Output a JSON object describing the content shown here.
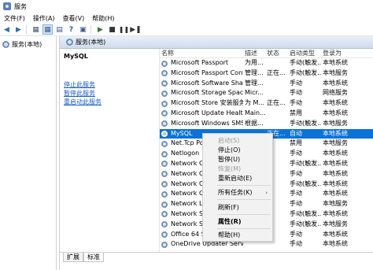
{
  "window": {
    "title": "服务"
  },
  "menubar": {
    "items": [
      "文件(F)",
      "操作(A)",
      "查看(V)",
      "帮助(H)"
    ]
  },
  "tree": {
    "item_label": "服务(本地)"
  },
  "content": {
    "header_title": "服务(本地)"
  },
  "description": {
    "service_name": "MySQL",
    "links": [
      "停止此服务",
      "暂停此服务",
      "重启动此服务"
    ]
  },
  "table": {
    "columns": [
      "名称",
      "描述",
      "状态",
      "启动类型",
      "登录为"
    ],
    "rows": [
      {
        "name": "Microsoft Passport",
        "desc": "为用...",
        "status": "",
        "startup": "手动(触发...",
        "logon": "本地系统"
      },
      {
        "name": "Microsoft Passport Container",
        "desc": "管理...",
        "status": "正在...",
        "startup": "手动(触发...",
        "logon": "本地服务"
      },
      {
        "name": "Microsoft Software Shado...",
        "desc": "管理...",
        "status": "",
        "startup": "手动",
        "logon": "本地系统"
      },
      {
        "name": "Microsoft Storage Spaces S...",
        "desc": "Micr...",
        "status": "",
        "startup": "手动",
        "logon": "网络服务"
      },
      {
        "name": "Microsoft Store 安装服务",
        "desc": "为 M...",
        "status": "正在...",
        "startup": "手动",
        "logon": "本地系统"
      },
      {
        "name": "Microsoft Update Health S...",
        "desc": "Main...",
        "status": "",
        "startup": "禁用",
        "logon": "本地系统"
      },
      {
        "name": "Microsoft Windows SMS 路...",
        "desc": "根据...",
        "status": "",
        "startup": "手动(触发...",
        "logon": "本地服务"
      },
      {
        "name": "MySQL",
        "desc": "",
        "status": "正在...",
        "startup": "自动",
        "logon": "本地系统",
        "selected": true
      },
      {
        "name": "Net.Tcp Port",
        "desc": "",
        "status": "",
        "startup": "禁用",
        "logon": "本地服务"
      },
      {
        "name": "Netlogon",
        "desc": "",
        "status": "",
        "startup": "手动",
        "logon": "本地系统"
      },
      {
        "name": "Network Con",
        "desc": "",
        "status": "",
        "startup": "手动(触发...",
        "logon": "本地系统"
      },
      {
        "name": "Network Con",
        "desc": "",
        "status": "",
        "startup": "手动",
        "logon": "本地系统"
      },
      {
        "name": "Network Con",
        "desc": "",
        "status": "",
        "startup": "手动(触发...",
        "logon": "本地系统"
      },
      {
        "name": "Network Con",
        "desc": "",
        "status": "",
        "startup": "手动",
        "logon": "本地系统"
      },
      {
        "name": "Network List",
        "desc": "",
        "status": "",
        "startup": "手动",
        "logon": "本地服务"
      },
      {
        "name": "Network Setu",
        "desc": "",
        "status": "",
        "startup": "手动(触发...",
        "logon": "本地系统"
      },
      {
        "name": "Network Stor",
        "desc": "",
        "status": "",
        "startup": "手动(触发...",
        "logon": "本地服务"
      },
      {
        "name": "Office 64 Source Engine",
        "desc": "",
        "status": "",
        "startup": "手动",
        "logon": "本地系统"
      },
      {
        "name": "OneDrive Updater Service",
        "desc": "",
        "status": "",
        "startup": "手动",
        "logon": "本地系统"
      }
    ]
  },
  "tabs": [
    "扩展",
    "标准"
  ],
  "context_menu": {
    "items": [
      {
        "label": "启动(S)",
        "disabled": true
      },
      {
        "label": "停止(O)"
      },
      {
        "label": "暂停(U)"
      },
      {
        "label": "恢复(M)",
        "disabled": true
      },
      {
        "label": "重新启动(E)"
      },
      {
        "label": "所有任务(K)",
        "submenu": "›"
      },
      {
        "label": "刷新(F)"
      },
      {
        "label": "属性(R)",
        "bold": true
      },
      {
        "label": "帮助(H)"
      }
    ]
  }
}
